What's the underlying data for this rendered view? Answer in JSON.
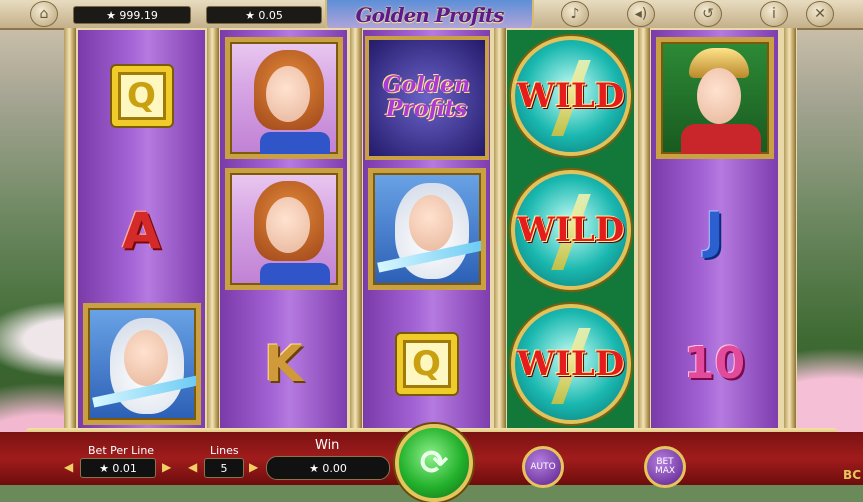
{
  "header": {
    "balance": "★ 999.19",
    "stake": "★ 0.05",
    "logo": "Golden Profits"
  },
  "reels": [
    [
      "Q",
      "A",
      "zeus"
    ],
    [
      "woman",
      "woman",
      "K"
    ],
    [
      "logo",
      "zeus",
      "Q"
    ],
    [
      "WILD",
      "WILD",
      "WILD"
    ],
    [
      "hermes",
      "J",
      "10"
    ]
  ],
  "symbols": {
    "wild_label": "WILD",
    "logo_line1": "Golden",
    "logo_line2": "Profits"
  },
  "footer": {
    "bet_per_line_label": "Bet Per Line",
    "bet_per_line_value": "★ 0.01",
    "lines_label": "Lines",
    "lines_value": "5",
    "win_label": "Win",
    "win_value": "★ 0.00",
    "auto_label": "AUTO",
    "bet_max_label": "BET MAX",
    "corner_text": "BC"
  },
  "icons": [
    "home-icon",
    "music-icon",
    "sound-icon",
    "history-icon",
    "info-icon",
    "close-icon",
    "spin-icon"
  ],
  "colors": {
    "reel": "#9a56cc",
    "frame": "#e9d9a8",
    "bottom": "#a11c1c",
    "spin": "#23b12c"
  }
}
